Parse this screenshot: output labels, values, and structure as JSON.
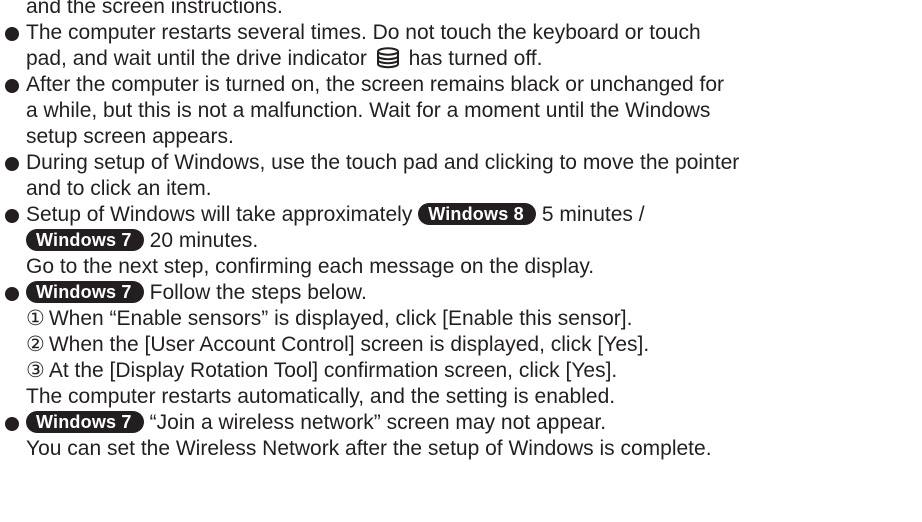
{
  "cut_top_line": "and the screen instructions.",
  "items": [
    {
      "lines": [
        "The computer restarts several times. Do not touch the keyboard or touch",
        "pad, and wait until the drive indicator",
        "has turned off."
      ],
      "icon": "drive-indicator-icon"
    },
    {
      "lines": [
        "After the computer is turned on, the screen remains black or unchanged for",
        "a while, but this is not a malfunction. Wait for a moment until the Windows",
        "setup screen appears."
      ]
    },
    {
      "lines": [
        "During setup of Windows, use the touch pad and clicking to move the pointer",
        "and to click an item."
      ]
    },
    {
      "line1_text": "Setup of Windows will take approximately",
      "badge_win8": "Windows 8",
      "line1_after": "5 minutes /",
      "badge_win7": "Windows 7",
      "line2_after": "20 minutes.",
      "line3": "Go to the next step, confirming each message on the display."
    },
    {
      "badge": "Windows 7",
      "text": "Follow the steps below.",
      "steps": [
        {
          "num": "①",
          "text": "When “Enable sensors” is displayed, click [Enable this sensor]."
        },
        {
          "num": "②",
          "text": "When the [User Account Control] screen is displayed, click [Yes]."
        },
        {
          "num": "③",
          "text": "At the [Display Rotation Tool] confirmation screen, click [Yes]."
        }
      ],
      "after": "The computer restarts automatically, and the setting is enabled."
    },
    {
      "badge": "Windows 7",
      "text": "“Join a wireless network” screen may not appear.",
      "line2": "You can set the Wireless Network after the setup of Windows is complete."
    }
  ]
}
